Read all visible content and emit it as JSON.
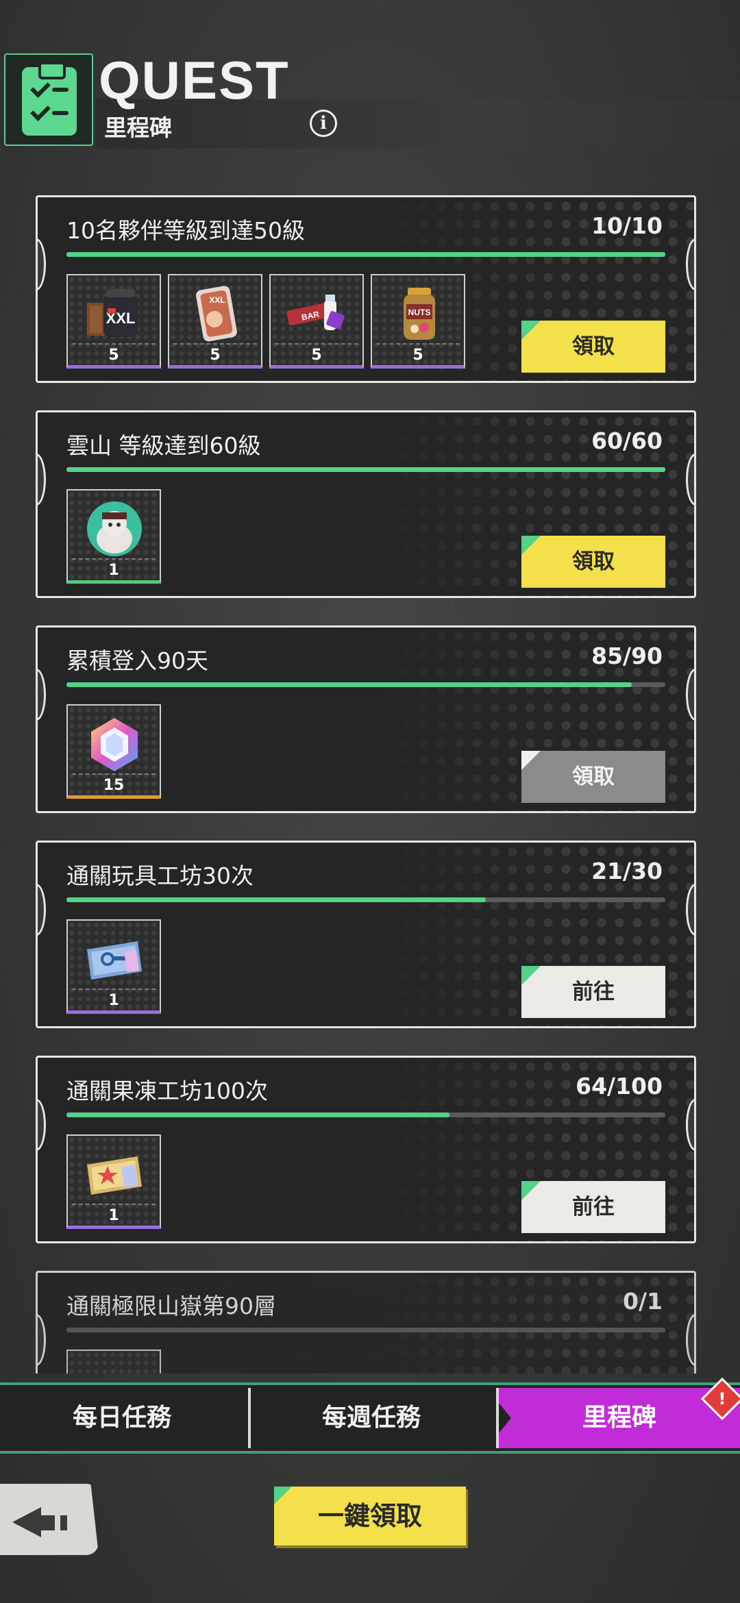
{
  "header": {
    "title": "QUEST",
    "subtitle": "里程碑",
    "info_symbol": "i",
    "icon": "clipboard-check-icon"
  },
  "quests": [
    {
      "title": "10名夥伴等級到達50級",
      "progress_text": "10/10",
      "progress_fraction": 1.0,
      "rewards": [
        {
          "icon": "protein-tub-icon",
          "qty": "5",
          "rarity": "purple"
        },
        {
          "icon": "protein-card-icon",
          "qty": "5",
          "rarity": "purple"
        },
        {
          "icon": "protein-bar-icon",
          "qty": "5",
          "rarity": "purple"
        },
        {
          "icon": "nuts-jar-icon",
          "qty": "5",
          "rarity": "purple"
        }
      ],
      "button_label": "領取",
      "button_style": "yellow"
    },
    {
      "title": "雲山 等級達到60級",
      "progress_text": "60/60",
      "progress_fraction": 1.0,
      "rewards": [
        {
          "icon": "character-avatar-icon",
          "qty": "1",
          "rarity": "green"
        }
      ],
      "button_label": "領取",
      "button_style": "yellow"
    },
    {
      "title": "累積登入90天",
      "progress_text": "85/90",
      "progress_fraction": 0.944,
      "rewards": [
        {
          "icon": "gem-icon",
          "qty": "15",
          "rarity": "gold"
        }
      ],
      "button_label": "領取",
      "button_style": "grey"
    },
    {
      "title": "通關玩具工坊30次",
      "progress_text": "21/30",
      "progress_fraction": 0.7,
      "rewards": [
        {
          "icon": "blueprint-ticket-icon",
          "qty": "1",
          "rarity": "purple"
        }
      ],
      "button_label": "前往",
      "button_style": "light"
    },
    {
      "title": "通關果凍工坊100次",
      "progress_text": "64/100",
      "progress_fraction": 0.64,
      "rewards": [
        {
          "icon": "star-ticket-icon",
          "qty": "1",
          "rarity": "purple"
        }
      ],
      "button_label": "前往",
      "button_style": "light"
    },
    {
      "title": "通關極限山嶽第90層",
      "progress_text": "0/1",
      "progress_fraction": 0.0,
      "rewards": [],
      "button_label": "",
      "button_style": "light"
    }
  ],
  "tabs": [
    {
      "label": "每日任務",
      "active": false
    },
    {
      "label": "每週任務",
      "active": false
    },
    {
      "label": "里程碑",
      "active": true
    }
  ],
  "alert_symbol": "!",
  "claim_all_label": "一鍵領取",
  "colors": {
    "accent_green": "#52d387",
    "button_yellow": "#f3e04b",
    "active_tab": "#c12bd8"
  }
}
